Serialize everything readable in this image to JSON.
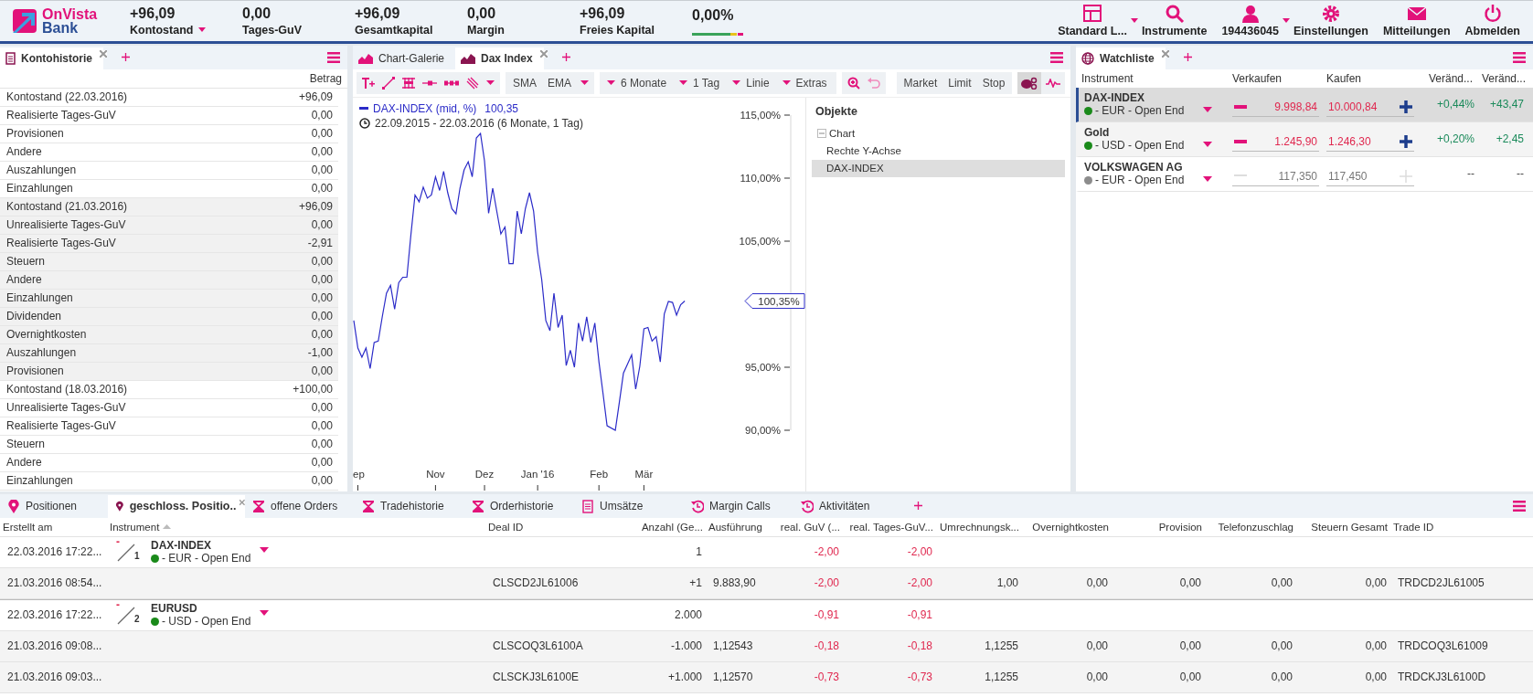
{
  "header": {
    "logo": {
      "line1": "OnVista",
      "line2": "Bank"
    },
    "stats": [
      {
        "value": "+96,09",
        "label": "Kontostand",
        "dropdown": true
      },
      {
        "value": "0,00",
        "label": "Tages-GuV",
        "dropdown": false
      },
      {
        "value": "+96,09",
        "label": "Gesamtkapital",
        "dropdown": false
      },
      {
        "value": "0,00",
        "label": "Margin",
        "dropdown": false
      },
      {
        "value": "+96,09",
        "label": "Freies Kapital",
        "dropdown": false
      },
      {
        "value": "0,00%",
        "kind": "meter"
      }
    ],
    "nav": [
      {
        "label": "Standard L...",
        "kind": "layout",
        "dropdown": true
      },
      {
        "label": "Instrumente",
        "kind": "search",
        "dropdown": false
      },
      {
        "label": "194436045",
        "kind": "user",
        "dropdown": true
      },
      {
        "label": "Einstellungen",
        "kind": "settings",
        "dropdown": false
      },
      {
        "label": "Mitteilungen",
        "kind": "mail",
        "dropdown": false
      },
      {
        "label": "Abmelden",
        "kind": "power",
        "dropdown": false
      }
    ]
  },
  "account_history": {
    "tabs": [
      {
        "label": "Kontohistorie",
        "selected": true
      }
    ],
    "column": "Betrag",
    "groups": [
      {
        "rows": [
          {
            "label": "Kontostand (22.03.2016)",
            "value": "+96,09"
          },
          {
            "label": "Realisierte Tages-GuV",
            "value": "0,00"
          },
          {
            "label": "Provisionen",
            "value": "0,00"
          },
          {
            "label": "Andere",
            "value": "0,00"
          },
          {
            "label": "Auszahlungen",
            "value": "0,00"
          },
          {
            "label": "Einzahlungen",
            "value": "0,00"
          }
        ]
      },
      {
        "rows": [
          {
            "label": "Kontostand (21.03.2016)",
            "value": "+96,09"
          },
          {
            "label": "Unrealisierte Tages-GuV",
            "value": "0,00"
          },
          {
            "label": "Realisierte Tages-GuV",
            "value": "-2,91"
          },
          {
            "label": "Steuern",
            "value": "0,00"
          },
          {
            "label": "Andere",
            "value": "0,00"
          },
          {
            "label": "Einzahlungen",
            "value": "0,00"
          },
          {
            "label": "Dividenden",
            "value": "0,00"
          },
          {
            "label": "Overnightkosten",
            "value": "0,00"
          },
          {
            "label": "Auszahlungen",
            "value": "-1,00"
          },
          {
            "label": "Provisionen",
            "value": "0,00"
          }
        ]
      },
      {
        "rows": [
          {
            "label": "Kontostand (18.03.2016)",
            "value": "+100,00"
          },
          {
            "label": "Unrealisierte Tages-GuV",
            "value": "0,00"
          },
          {
            "label": "Realisierte Tages-GuV",
            "value": "0,00"
          },
          {
            "label": "Steuern",
            "value": "0,00"
          },
          {
            "label": "Andere",
            "value": "0,00"
          },
          {
            "label": "Einzahlungen",
            "value": "0,00"
          }
        ]
      }
    ]
  },
  "chart_panel": {
    "tabs": [
      {
        "label": "Chart-Galerie",
        "selected": false
      },
      {
        "label": "Dax Index",
        "selected": true
      }
    ],
    "toolbar": {
      "indicators": [
        "SMA",
        "EMA"
      ],
      "dropdowns": [
        "6 Monate",
        "1 Tag",
        "Linie",
        "Extras"
      ],
      "orders": [
        "Market",
        "Limit",
        "Stop"
      ],
      "views": [
        {
          "kind": "objects",
          "selected": true
        },
        {
          "kind": "indicator",
          "selected": false
        }
      ]
    },
    "legend": {
      "value": "100,35",
      "range": "22.09.2015 - 22.03.2016 (6 Monate, 1 Tag)"
    },
    "chart_data": {
      "type": "line",
      "categories": [
        null,
        "ep",
        null,
        null,
        null,
        null,
        null,
        null,
        null,
        null,
        null,
        null,
        null,
        null,
        null,
        null,
        null,
        null,
        null,
        null,
        "Nov",
        null,
        null,
        null,
        null,
        null,
        null,
        null,
        null,
        null,
        null,
        null,
        "Dez",
        null,
        null,
        null,
        null,
        null,
        null,
        null,
        null,
        null,
        null,
        null,
        null,
        "Jan '16",
        null,
        null,
        null,
        null,
        null,
        null,
        null,
        null,
        null,
        null,
        null,
        null,
        null,
        null,
        "Feb",
        null,
        null,
        null,
        null,
        null,
        null,
        null,
        null,
        null,
        null,
        "Mär",
        null,
        null,
        null,
        null,
        null,
        null,
        null,
        null,
        null,
        null
      ],
      "series": [
        {
          "name": "DAX-INDEX (mid, %)",
          "color": "#2b2bc8",
          "values": [
            98.7,
            96.52,
            95.8,
            96.52,
            94.89,
            96.96,
            97.07,
            99.06,
            100.87,
            101.49,
            99.6,
            101.7,
            102.14,
            102.14,
            105.58,
            108.66,
            108.12,
            109.28,
            108.41,
            108.66,
            110.11,
            109.02,
            110.54,
            108.84,
            107.57,
            107.17,
            109.2,
            110.65,
            111.3,
            110.11,
            113.19,
            113.55,
            111.38,
            107.21,
            109.2,
            107.39,
            105.58,
            106.12,
            103.22,
            103.22,
            107.39,
            105.58,
            107.57,
            108.84,
            107.39,
            104.13,
            101.96,
            98.7,
            97.9,
            100.87,
            98.15,
            99.13,
            95.14,
            96.34,
            95.0,
            98.51,
            97.07,
            98.99,
            96.96,
            98.51,
            95.43,
            92.9,
            90.36,
            null,
            90.0,
            92.25,
            94.53,
            95.25,
            95.98,
            93.26,
            95.07,
            98.04,
            98.15,
            97.07,
            97.43,
            95.43,
            99.24,
            100.22,
            100.14,
            99.13,
            99.96,
            100.25
          ]
        }
      ],
      "ylim": [
        90,
        115
      ],
      "yticks": [
        {
          "value": 90,
          "label": "90,00%"
        },
        {
          "value": 95,
          "label": "95,00%"
        },
        {
          "value": 105,
          "label": "105,00%"
        },
        {
          "value": 110,
          "label": "110,00%"
        },
        {
          "value": 115,
          "label": "115,00%"
        }
      ],
      "annotations": [
        "100,35%"
      ]
    },
    "objects": {
      "title": "Objekte",
      "tree": [
        {
          "label": "Chart",
          "expanded": true,
          "selected": false,
          "children": [
            {
              "label": "Rechte Y-Achse",
              "selected": false
            },
            {
              "label": "DAX-INDEX",
              "selected": true
            }
          ]
        }
      ]
    }
  },
  "watchlist": {
    "tabs": [
      {
        "label": "Watchliste",
        "selected": true
      }
    ],
    "columns": [
      "Instrument",
      "Verkaufen",
      "Kaufen",
      "Veränd...",
      "Veränd..."
    ],
    "rows": [
      {
        "name": "DAX-INDEX",
        "currency": "- EUR - Open End",
        "color": "#1a8a1a",
        "selected": true,
        "disabled": false,
        "sell": "9.998,84",
        "buy": "10.000,84",
        "change_pct": "+0,44%",
        "change": "+43,47"
      },
      {
        "name": "Gold",
        "currency": "- USD - Open End",
        "color": "#1a8a1a",
        "selected": false,
        "disabled": false,
        "sell": "1.245,90",
        "buy": "1.246,30",
        "change_pct": "+0,20%",
        "change": "+2,45"
      },
      {
        "name": "VOLKSWAGEN AG",
        "currency": "- EUR - Open End",
        "color": "#8c8c8c",
        "selected": false,
        "disabled": true,
        "sell": "117,350",
        "buy": "117,450",
        "change_pct": "--",
        "change": "--"
      }
    ]
  },
  "bottom_panel": {
    "tabs": [
      {
        "label": "Positionen",
        "kind": "pin",
        "selected": false
      },
      {
        "label": "geschloss. Positio..",
        "kind": "pin",
        "selected": true
      },
      {
        "label": "offene Orders",
        "kind": "hourglass",
        "selected": false
      },
      {
        "label": "Tradehistorie",
        "kind": "hourglass",
        "selected": false
      },
      {
        "label": "Orderhistorie",
        "kind": "hourglass",
        "selected": false
      },
      {
        "label": "Umsätze",
        "kind": "document",
        "selected": false
      },
      {
        "label": "Margin Calls",
        "kind": "history",
        "selected": false
      },
      {
        "label": "Aktivitäten",
        "kind": "history",
        "selected": false
      }
    ],
    "columns": [
      {
        "label": "Erstellt am",
        "sorted": false
      },
      {
        "label": "Instrument",
        "sorted": true
      },
      {
        "label": "Deal ID",
        "sorted": false
      },
      {
        "label": "Anzahl (Ge...",
        "sorted": false
      },
      {
        "label": "Ausführung",
        "sorted": false
      },
      {
        "label": "real. GuV (...",
        "sorted": false
      },
      {
        "label": "real. Tages-GuV...",
        "sorted": false
      },
      {
        "label": "Umrechnungsk...",
        "sorted": false
      },
      {
        "label": "Overnightkosten",
        "sorted": false
      },
      {
        "label": "Provision",
        "sorted": false
      },
      {
        "label": "Telefonzuschlag",
        "sorted": false
      },
      {
        "label": "Steuern Gesamt",
        "sorted": false
      },
      {
        "label": "Trade ID",
        "sorted": false
      }
    ],
    "rows": [
      {
        "kind": "position",
        "created": "22.03.2016 17:22...",
        "instrument": {
          "sign": "-",
          "number": "1",
          "name": "DAX-INDEX",
          "currency": "- EUR - Open End",
          "color": "#1a8a1a"
        },
        "quantity": "1",
        "real_pnl": "-2,00",
        "real_day_pnl": "-2,00"
      },
      {
        "kind": "trade",
        "created": "21.03.2016 08:54...",
        "deal_id": "CLSCD2JL61006",
        "quantity": "+1",
        "execution": "9.883,90",
        "real_pnl": "-2,00",
        "real_day_pnl": "-2,00",
        "fx_rate": "1,00",
        "overnight": "0,00",
        "commission": "0,00",
        "phone_fee": "0,00",
        "taxes": "0,00",
        "trade_id": "TRDCD2JL61005"
      },
      {
        "kind": "position",
        "created": "22.03.2016 17:22...",
        "instrument": {
          "sign": "-",
          "number": "2",
          "name": "EURUSD",
          "currency": "- USD - Open End",
          "color": "#1a8a1a"
        },
        "quantity": "2.000",
        "real_pnl": "-0,91",
        "real_day_pnl": "-0,91"
      },
      {
        "kind": "trade",
        "created": "21.03.2016 09:08...",
        "deal_id": "CLSCOQ3L6100A",
        "quantity": "-1.000",
        "execution": "1,12543",
        "real_pnl": "-0,18",
        "real_day_pnl": "-0,18",
        "fx_rate": "1,1255",
        "overnight": "0,00",
        "commission": "0,00",
        "phone_fee": "0,00",
        "taxes": "0,00",
        "trade_id": "TRDCOQ3L61009"
      },
      {
        "kind": "trade",
        "created": "21.03.2016 09:03...",
        "deal_id": "CLSCKJ3L6100E",
        "quantity": "+1.000",
        "execution": "1,12570",
        "real_pnl": "-0,73",
        "real_day_pnl": "-0,73",
        "fx_rate": "1,1255",
        "overnight": "0,00",
        "commission": "0,00",
        "phone_fee": "0,00",
        "taxes": "0,00",
        "trade_id": "TRDCKJ3L6100D"
      }
    ]
  }
}
